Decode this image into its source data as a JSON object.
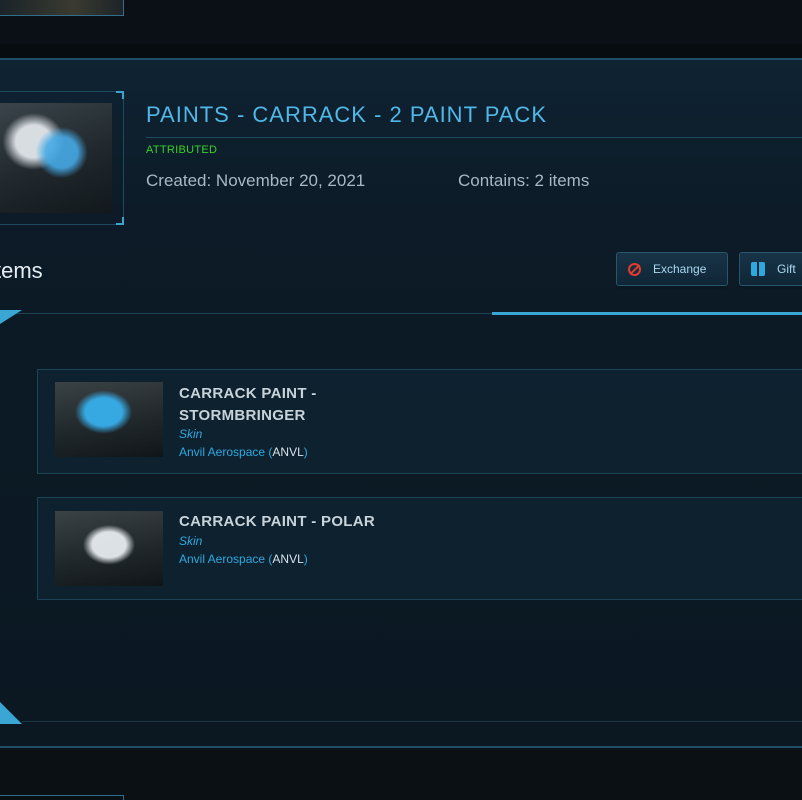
{
  "pledge": {
    "title": "PAINTS - CARRACK - 2 PAINT PACK",
    "status": "ATTRIBUTED",
    "created": "Created: November 20, 2021",
    "contains": "Contains: 2 items"
  },
  "items_section": {
    "heading": "tems",
    "actions": {
      "exchange_label": "Exchange",
      "gift_label": "Gift"
    },
    "items": [
      {
        "name": "CARRACK PAINT - STORMBRINGER",
        "type": "Skin",
        "manufacturer": "Anvil Aerospace",
        "code": "ANVL"
      },
      {
        "name": "CARRACK PAINT - POLAR",
        "type": "Skin",
        "manufacturer": "Anvil Aerospace",
        "code": "ANVL"
      }
    ]
  },
  "colors": {
    "accent": "#4fb8e8",
    "attributed": "#35d12a",
    "exchange_icon": "#e23a2e",
    "link": "#2fa8e0"
  },
  "icons": {
    "exchange": "no-entry-icon",
    "gift": "gift-box-icon"
  }
}
